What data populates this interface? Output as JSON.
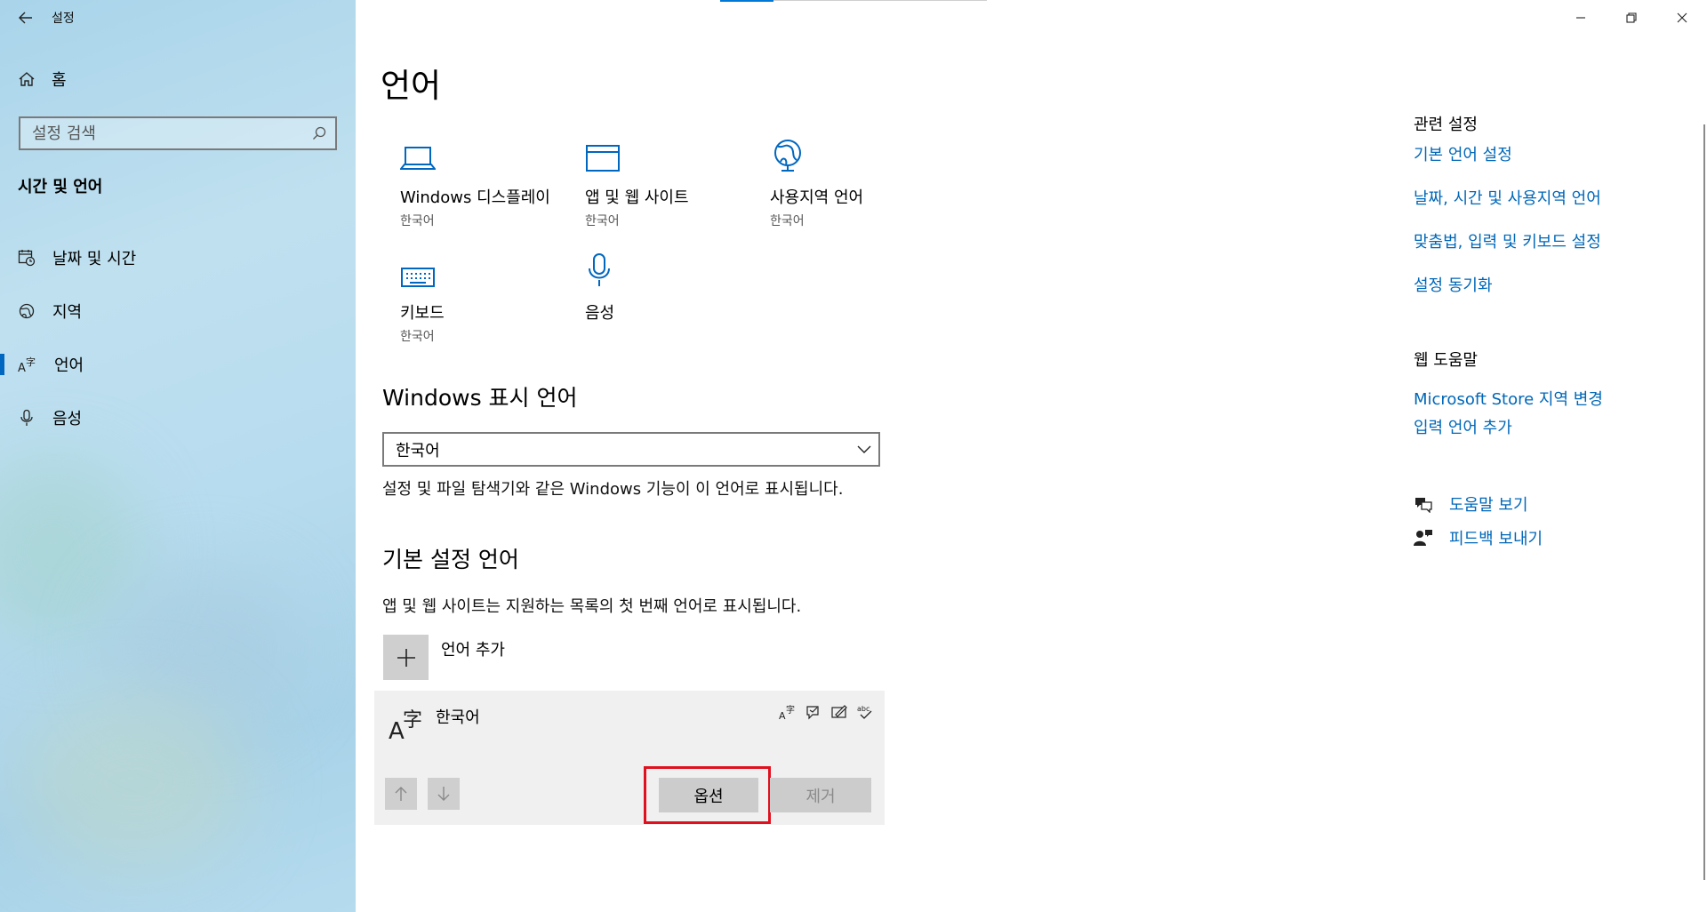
{
  "window": {
    "title": "설정",
    "controls": {
      "minimize": "minimize-icon",
      "restore": "restore-icon",
      "close": "close-icon"
    }
  },
  "sidebar": {
    "home_label": "홈",
    "search_placeholder": "설정 검색",
    "section_title": "시간 및 언어",
    "items": [
      {
        "label": "날짜 및 시간",
        "icon": "calendar-clock-icon"
      },
      {
        "label": "지역",
        "icon": "globe-region-icon"
      },
      {
        "label": "언어",
        "icon": "language-icon",
        "selected": true
      },
      {
        "label": "음성",
        "icon": "microphone-icon"
      }
    ]
  },
  "main": {
    "page_title": "언어",
    "tiles": [
      {
        "label": "Windows 디스플레이",
        "sub": "한국어",
        "icon": "laptop-icon"
      },
      {
        "label": "앱 및 웹 사이트",
        "sub": "한국어",
        "icon": "window-icon"
      },
      {
        "label": "사용지역 언어",
        "sub": "한국어",
        "icon": "globe-icon"
      },
      {
        "label": "키보드",
        "sub": "한국어",
        "icon": "keyboard-icon"
      },
      {
        "label": "음성",
        "sub": "",
        "icon": "microphone-icon"
      }
    ],
    "display_language": {
      "heading": "Windows 표시 언어",
      "selected": "한국어",
      "description": "설정 및 파일 탐색기와 같은 Windows 기능이 이 언어로 표시됩니다."
    },
    "preferred": {
      "heading": "기본 설정 언어",
      "description": "앱 및 웹 사이트는 지원하는 목록의 첫 번째 언어로 표시됩니다.",
      "add_label": "언어 추가",
      "language": {
        "name": "한국어",
        "features": [
          "display-language-icon",
          "speech-icon",
          "handwriting-icon",
          "spellcheck-icon"
        ]
      },
      "options_label": "옵션",
      "remove_label": "제거"
    }
  },
  "related": {
    "heading": "관련 설정",
    "links": [
      "기본 언어 설정",
      "날짜, 시간 및 사용지역 언어",
      "맞춤법, 입력 및 키보드 설정",
      "설정 동기화"
    ]
  },
  "web_help": {
    "heading": "웹 도움말",
    "links": [
      "Microsoft Store 지역 변경",
      "입력 언어 추가"
    ]
  },
  "help": {
    "get_help": "도움말 보기",
    "feedback": "피드백 보내기"
  },
  "colors": {
    "accent": "#0067c0",
    "link": "#0067b8",
    "highlight": "#e0101e",
    "sidebar_bg": "#b8dcef"
  }
}
